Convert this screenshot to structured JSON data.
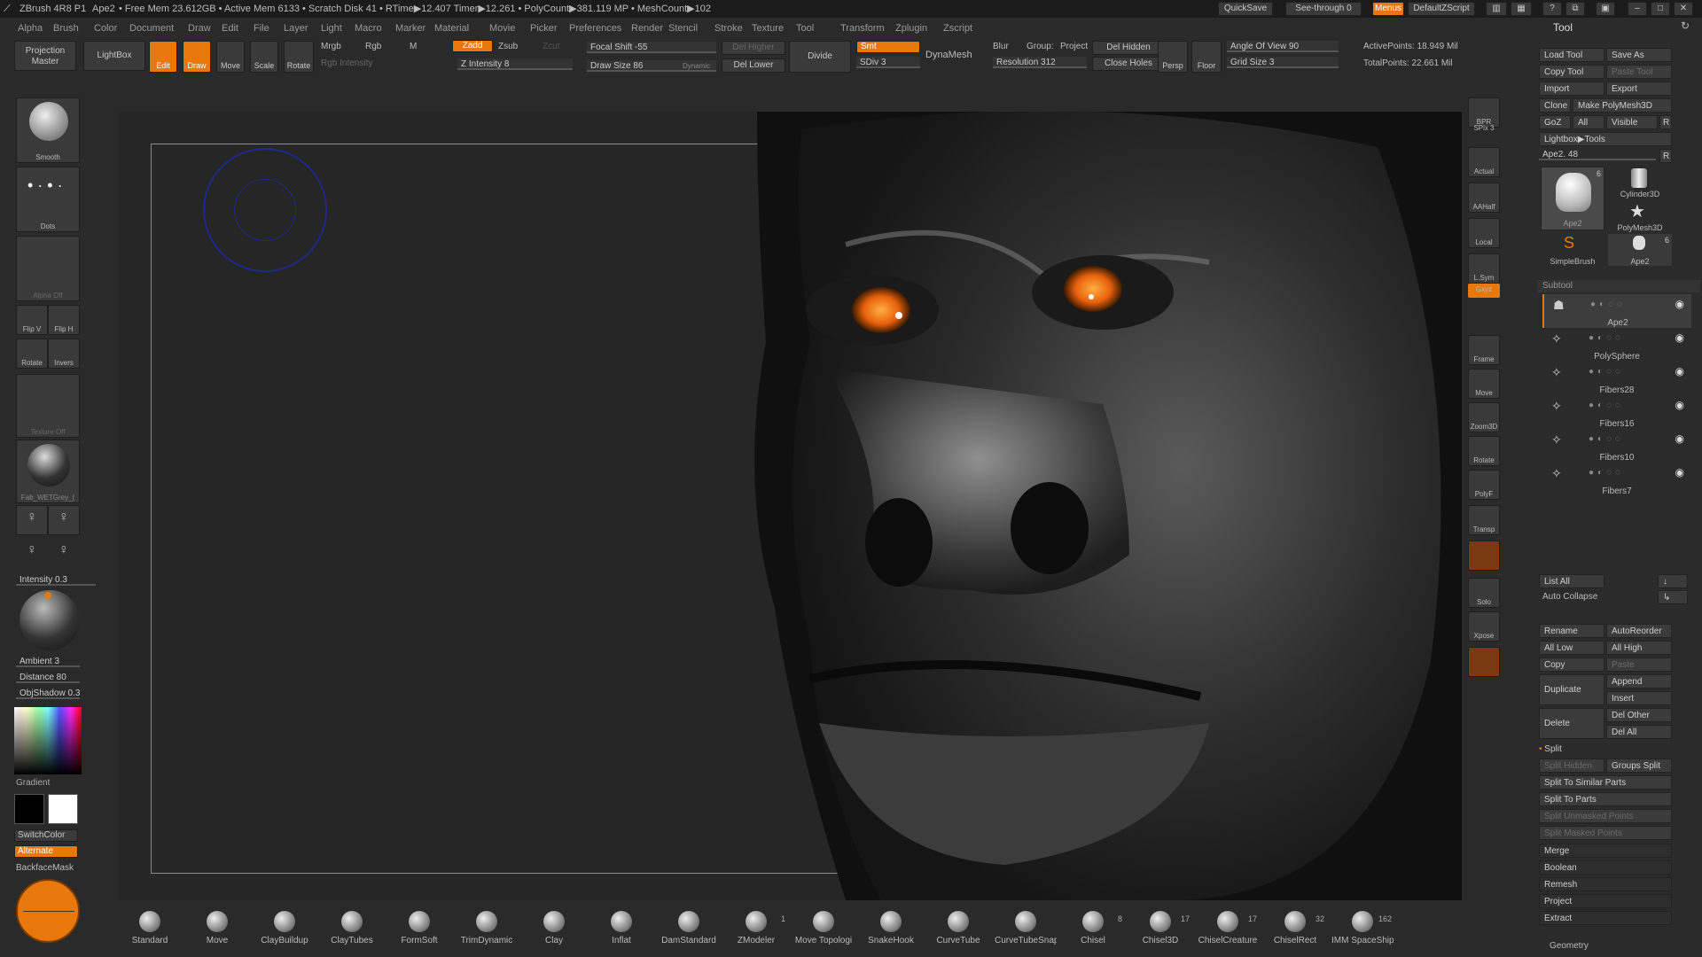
{
  "titlebar": {
    "app": "ZBrush 4R8 P1",
    "project": "Ape2",
    "stats": "• Free Mem 23.612GB • Active Mem 6133 • Scratch Disk 41 • RTime▶12.407 Timer▶12.261 • PolyCount▶381.119 MP • MeshCount▶102",
    "quicksave": "QuickSave",
    "see_through": "See-through  0",
    "menus": "Menus",
    "default_zscript": "DefaultZScript"
  },
  "menubar": {
    "items": [
      "Alpha",
      "Brush",
      "Color",
      "Document",
      "Draw",
      "Edit",
      "File",
      "Layer",
      "Light",
      "Macro",
      "Marker",
      "Material",
      "Movie",
      "Picker",
      "Preferences",
      "Render",
      "Stencil",
      "Stroke",
      "Texture",
      "Tool",
      "Transform",
      "Zplugin",
      "Zscript"
    ]
  },
  "topshelf": {
    "projection_master": "Projection Master",
    "lightbox": "LightBox",
    "edit": "Edit",
    "draw": "Draw",
    "move": "Move",
    "scale": "Scale",
    "rotate": "Rotate",
    "mrgb": "Mrgb",
    "rgb": "Rgb",
    "m": "M",
    "rgb_intensity": "Rgb Intensity",
    "zadd": "Zadd",
    "zsub": "Zsub",
    "zcut": "Zcut",
    "z_intensity": "Z Intensity 8",
    "focal_shift": "Focal Shift -55",
    "draw_size": "Draw Size 86",
    "dynamic": "Dynamic",
    "del_higher": "Del Higher",
    "del_lower": "Del Lower",
    "divide": "Divide",
    "smt": "Smt",
    "sdiv": "SDiv 3",
    "dynamesh": "DynaMesh",
    "blur": "Blur",
    "groups": "Group:",
    "project": "Project",
    "resolution": "Resolution 312",
    "del_hidden": "Del Hidden",
    "close_holes": "Close Holes",
    "persp": "Persp",
    "floor": "Floor",
    "angle_of_view": "Angle Of View 90",
    "grid_size": "Grid Size 3",
    "active_points": "ActivePoints: 18.949 Mil",
    "total_points": "TotalPoints: 22.661 Mil"
  },
  "leftbar": {
    "smooth": "Smooth",
    "dots": "Dots",
    "alpha_off": "Alpha Off",
    "flip_v": "Flip V",
    "flip_h": "Flip H",
    "rotate": "Rotate",
    "invers": "Invers",
    "texture_off": "Texture Off",
    "material": "Fab_WETGrey_(",
    "intensity": "Intensity 0.3",
    "ambient": "Ambient 3",
    "distance": "Distance 80",
    "objshadow": "ObjShadow 0.3",
    "gradient": "Gradient",
    "switchcolor": "SwitchColor",
    "alternate": "Alternate",
    "backfacemask": "BackfaceMask"
  },
  "rightstrip": {
    "bpr": "BPR",
    "spix": "SPix 3",
    "actual": "Actual",
    "aahalf": "AAHalf",
    "local": "Local",
    "lsym": "L.Sym",
    "xyz": "Gxyz",
    "frame": "Frame",
    "move": "Move",
    "zoom3d": "Zoom3D",
    "rotate": "Rotate",
    "polyf": "PolyF",
    "transp": "Transp",
    "solo": "Solo",
    "xpose": "Xpose"
  },
  "toolpanel": {
    "title": "Tool",
    "load_tool": "Load Tool",
    "save_as": "Save As",
    "copy_tool": "Copy Tool",
    "paste_tool": "Paste Tool",
    "import": "Import",
    "export": "Export",
    "clone": "Clone",
    "make_polymesh": "Make PolyMesh3D",
    "goz": "GoZ",
    "all": "All",
    "visible": "Visible",
    "r": "R",
    "lightbox_tools": "Lightbox▶Tools",
    "current_tool": "Ape2. 48",
    "thumb_ape": "Ape2",
    "thumb_cyl": "Cylinder3D",
    "thumb_poly": "PolyMesh3D",
    "thumb_simple": "SimpleBrush",
    "thumb_ape2": "Ape2",
    "thumb_count1": "6",
    "thumb_count2": "6",
    "subtool_title": "Subtool",
    "subtools": [
      "Ape2",
      "PolySphere",
      "Fibers28",
      "Fibers16",
      "Fibers10",
      "Fibers7"
    ],
    "list_all": "List All",
    "auto_collapse": "Auto Collapse",
    "rename": "Rename",
    "autoreorder": "AutoReorder",
    "all_low": "All Low",
    "all_high": "All High",
    "copy": "Copy",
    "paste": "Paste",
    "duplicate": "Duplicate",
    "append": "Append",
    "insert": "Insert",
    "delete": "Delete",
    "del_other": "Del Other",
    "del_all": "Del All",
    "split": "Split",
    "split_hidden": "Split Hidden",
    "groups_split": "Groups Split",
    "split_similar": "Split To Similar Parts",
    "split_parts": "Split To Parts",
    "split_unmasked": "Split Unmasked Points",
    "split_masked": "Split Masked Points",
    "merge": "Merge",
    "boolean": "Boolean",
    "remesh": "Remesh",
    "project": "Project",
    "extract": "Extract",
    "geometry": "Geometry"
  },
  "brushes": [
    {
      "label": "Standard",
      "count": ""
    },
    {
      "label": "Move",
      "count": ""
    },
    {
      "label": "ClayBuildup",
      "count": ""
    },
    {
      "label": "ClayTubes",
      "count": ""
    },
    {
      "label": "FormSoft",
      "count": ""
    },
    {
      "label": "TrimDynamic",
      "count": ""
    },
    {
      "label": "Clay",
      "count": ""
    },
    {
      "label": "Inflat",
      "count": ""
    },
    {
      "label": "DamStandard",
      "count": ""
    },
    {
      "label": "ZModeler",
      "count": "1"
    },
    {
      "label": "Move Topologi",
      "count": ""
    },
    {
      "label": "SnakeHook",
      "count": ""
    },
    {
      "label": "CurveTube",
      "count": ""
    },
    {
      "label": "CurveTubeSnap",
      "count": ""
    },
    {
      "label": "Chisel",
      "count": "8"
    },
    {
      "label": "Chisel3D",
      "count": "17"
    },
    {
      "label": "ChiselCreature",
      "count": "17"
    },
    {
      "label": "ChiselRect",
      "count": "32"
    },
    {
      "label": "IMM SpaceShip",
      "count": "162"
    }
  ],
  "colors": {
    "accent": "#e8780c",
    "bg": "#2a2a2a",
    "canvas": "#262626"
  }
}
